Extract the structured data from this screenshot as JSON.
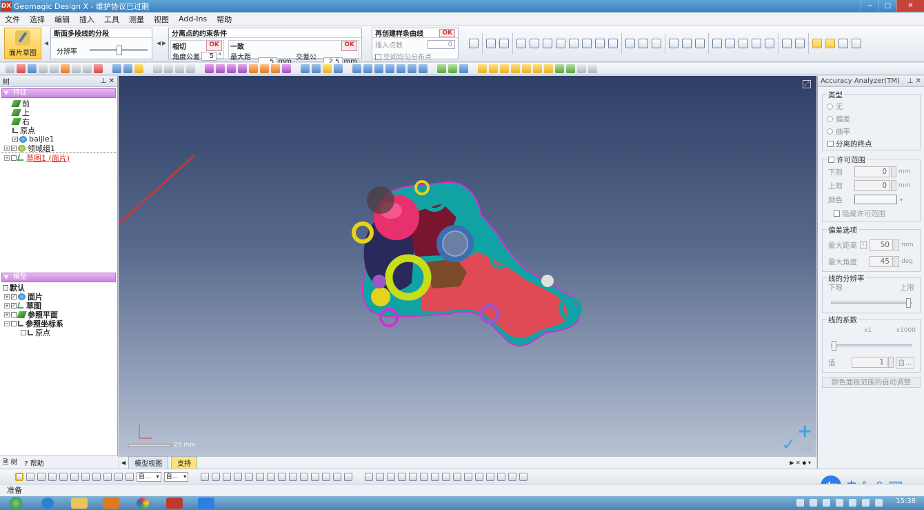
{
  "titlebar": {
    "logo": "DX",
    "title": "Geomagic Design X - 维护协议已过期"
  },
  "menu": [
    "文件",
    "选择",
    "编辑",
    "插入",
    "工具",
    "测量",
    "视图",
    "Add-Ins",
    "帮助"
  ],
  "ribbon": {
    "big_button": "面片草图",
    "panel1": {
      "title": "断面多段线的分段",
      "label": "分辨率"
    },
    "panel2": {
      "title": "分离点的约束条件",
      "sub1": {
        "title": "相切",
        "ok": "OK",
        "label": "角度公差",
        "value": "5",
        "unit": "°"
      },
      "sub2": {
        "title": "一致",
        "ok": "OK",
        "label1": "最大距离",
        "value1": "5",
        "unit1": "mm",
        "label2": "交差公差",
        "value2": "2.5",
        "unit2": "mm"
      }
    },
    "panel3": {
      "title": "再创建样条曲线",
      "ok": "OK",
      "label": "插入点数",
      "value": "0",
      "checkbox": "空间均匀分布点"
    }
  },
  "left_panel": {
    "header": "树",
    "feature_section": "特征",
    "feature_items": [
      "前",
      "上",
      "右",
      "原点",
      "baijie1",
      "领域组1",
      "草图1 (面片)"
    ],
    "model_section": "模型",
    "model_items": [
      "默认",
      "面片",
      "草图",
      "参照平面",
      "参照坐标系",
      "原点"
    ],
    "tabs": [
      "树",
      "帮助"
    ]
  },
  "viewport": {
    "scale_label": "25 mm",
    "tabs": [
      "模型视图",
      "支持"
    ]
  },
  "right_panel": {
    "header": "Accuracy Analyzer(TM)",
    "type_group": "类型",
    "type_options": [
      "无",
      "偏差",
      "曲率"
    ],
    "separate_endpoints": "分离的终点",
    "tolerance_group": "许可范围",
    "lower": "下限",
    "lower_value": "0",
    "lower_unit": "mm",
    "upper": "上限",
    "upper_value": "0",
    "upper_unit": "mm",
    "color": "颜色",
    "hide_tolerance": "隐藏许可范围",
    "deviation_group": "偏差选项",
    "max_distance": "最大距离",
    "max_distance_value": "50",
    "max_distance_unit": "mm",
    "max_angle": "最大角度",
    "max_angle_value": "45",
    "max_angle_unit": "deg",
    "line_resolution": "线的分辨率",
    "res_lower": "下限",
    "res_upper": "上限",
    "line_factor": "线的系数",
    "factor_min": "x1",
    "factor_max": "x1000",
    "value_label": "值",
    "value": "1",
    "auto": "自...",
    "auto_adjust": "颜色面板范围的自动调整"
  },
  "bottom_toolbar": {
    "combo1": "自...",
    "combo2": "自..."
  },
  "status": "准备",
  "taskbar": {
    "clock": "15:38",
    "ime": [
      "du",
      "中",
      "°,",
      "♀",
      "⌨"
    ]
  },
  "colors": {
    "accent": "#ffc948",
    "section": "#c986e0",
    "error": "#e02020"
  }
}
